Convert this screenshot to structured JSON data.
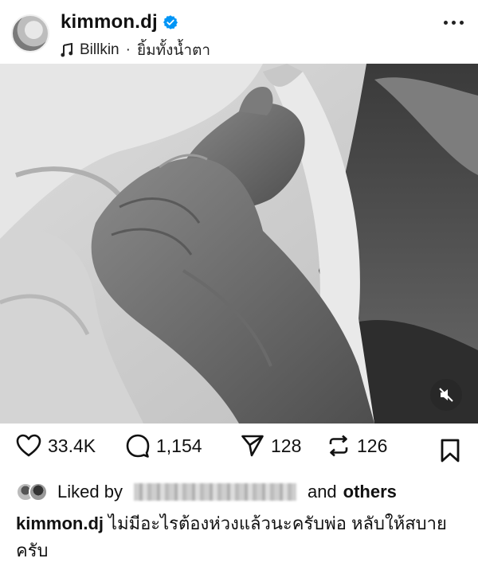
{
  "post": {
    "username": "kimmon.dj",
    "verified": true,
    "music": {
      "artist": "Billkin",
      "separator": "·",
      "song": "ยิ้มทั้งน้ำตา"
    }
  },
  "media": {
    "icons": {
      "mute": "speaker-muted-icon"
    }
  },
  "actions": {
    "likes": "33.4K",
    "comments": "1,154",
    "shares": "128",
    "reposts": "126"
  },
  "liked_by": {
    "prefix": "Liked by",
    "and": "and",
    "others": "others"
  },
  "caption": {
    "username": "kimmon.dj",
    "text": "ไม่มีอะไรต้องห่วงแล้วนะครับพ่อ หลับให้สบายครับ"
  },
  "colors": {
    "verified_blue": "#0095f6",
    "text": "#111111"
  }
}
